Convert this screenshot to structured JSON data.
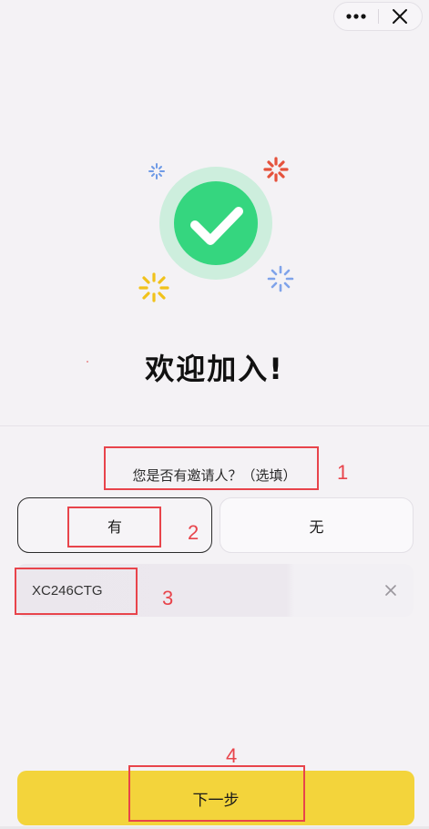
{
  "top_bar": {
    "more_icon": "ellipsis-icon",
    "close_icon": "close-icon"
  },
  "welcome": {
    "title": "欢迎加入!",
    "illustration_icon": "check-circle-icon",
    "colors": {
      "check_green": "#35d67f",
      "check_halo": "#cdeedd",
      "spark_red": "#e5523c",
      "spark_yellow": "#f1c21b",
      "spark_blue": "#6f9be6"
    }
  },
  "invite": {
    "question": "您是否有邀请人？（选填）",
    "options": [
      {
        "label": "有",
        "selected": true
      },
      {
        "label": "无",
        "selected": false
      }
    ],
    "code_value": "XC246CTG",
    "clear_icon": "clear-icon"
  },
  "next_button": {
    "label": "下一步",
    "color": "#f3d43b"
  },
  "annotations": [
    "1",
    "2",
    "3",
    "4"
  ]
}
